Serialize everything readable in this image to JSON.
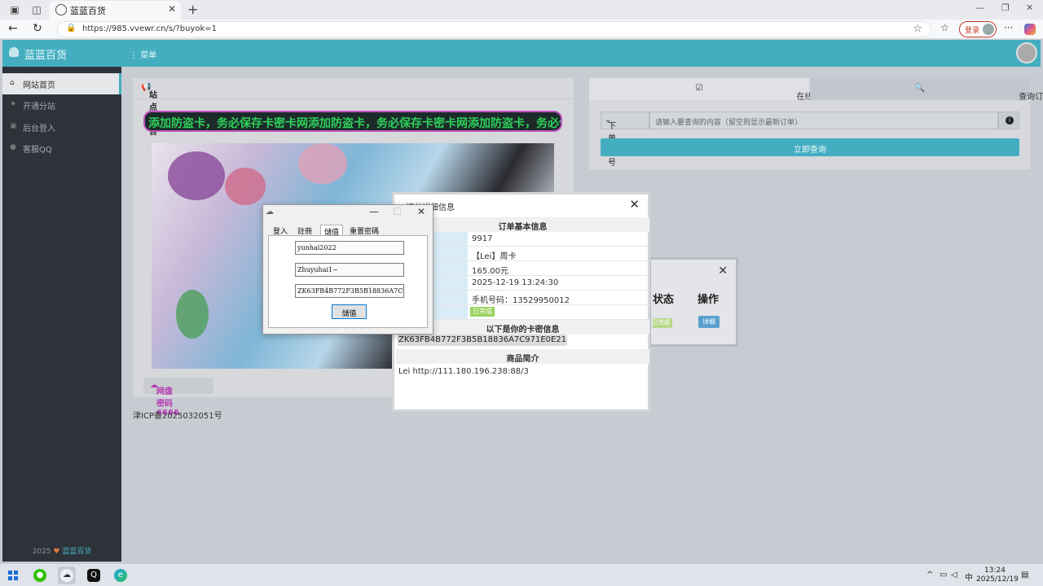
{
  "browser": {
    "tab_title": "蓝蓝百货",
    "url": "https://985.vvewr.cn/s/?buyok=1",
    "login_label": "登录"
  },
  "site": {
    "brand": "蓝蓝百货",
    "menu_label": "菜单"
  },
  "sidebar": {
    "items": [
      {
        "label": "网站首页"
      },
      {
        "label": "开通分站"
      },
      {
        "label": "后台登入"
      },
      {
        "label": "客服QQ"
      }
    ],
    "footer_year": "2025",
    "footer_brand": "蓝蓝百货"
  },
  "notice": {
    "title": "站点公告",
    "marquee": "添加防盗卡，务必保存卡密卡网添加防盗卡，务必保存卡密卡网添加防盗卡，务必保存",
    "netdisk_button": "网盘密码6666"
  },
  "icp": "津ICP备2025032051号",
  "query": {
    "tab_order": "在线下单",
    "tab_query": "查询订单",
    "select_value": "下单账号",
    "input_placeholder": "请输入要查询的内容（留空则显示最新订单）",
    "submit": "立即查询"
  },
  "orders_modal": {
    "col_status": "状态",
    "col_action": "操作",
    "status_badge": "已完成",
    "detail_button": "详细"
  },
  "detail_modal": {
    "title": "订单详细信息",
    "section_basic": "订单基本信息",
    "rows": [
      {
        "value": "9917"
      },
      {
        "value": "【Lei】周卡"
      },
      {
        "value": "165.00元"
      },
      {
        "value": "2025-12-19 13:24:30"
      },
      {
        "value": "手机号码：13529950012"
      }
    ],
    "status_badge": "已完成",
    "section_card": "以下是你的卡密信息",
    "card_key": "ZK63FB4B772F3B5B18836A7C971E0E21",
    "section_intro": "商品简介",
    "intro_text": "Lei  http://111.180.196.238:88/3"
  },
  "app_window": {
    "tabs": [
      "登入",
      "註冊",
      "儲值",
      "重置密碼"
    ],
    "username": "yunhai2022",
    "password": "Zhuyuhai1~",
    "card_code": "ZK63FB4B772F3B5B18836A7C971E0E21",
    "submit": "儲值"
  },
  "taskbar": {
    "time": "13:24",
    "date": "2025/12/19",
    "ime": "中"
  },
  "colors": {
    "accent": "#44aec0",
    "sidebar": "#2d3339",
    "marquee_text": "#2fd05a",
    "marquee_border": "#c054c0"
  }
}
